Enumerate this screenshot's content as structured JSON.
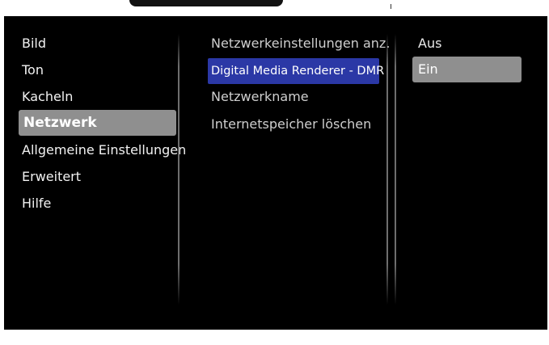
{
  "main_menu": {
    "items": [
      {
        "label": "Bild"
      },
      {
        "label": "Ton"
      },
      {
        "label": "Kacheln"
      },
      {
        "label": "Netzwerk",
        "selected": true
      },
      {
        "label": "Allgemeine Einstellungen"
      },
      {
        "label": "Erweitert"
      },
      {
        "label": "Hilfe"
      }
    ]
  },
  "submenu": {
    "items": [
      {
        "label": "Netzwerkeinstellungen anz."
      },
      {
        "label": "Digital Media Renderer - DMR",
        "focused": true
      },
      {
        "label": "Netzwerkname"
      },
      {
        "label": "Internetspeicher löschen"
      }
    ]
  },
  "options": {
    "items": [
      {
        "label": "Aus"
      },
      {
        "label": "Ein",
        "selected": true
      }
    ]
  },
  "colors": {
    "background": "#000000",
    "selection_gray": "#8f8f8f",
    "focus_blue": "#2b38a6",
    "text": "#f2f2f2"
  }
}
